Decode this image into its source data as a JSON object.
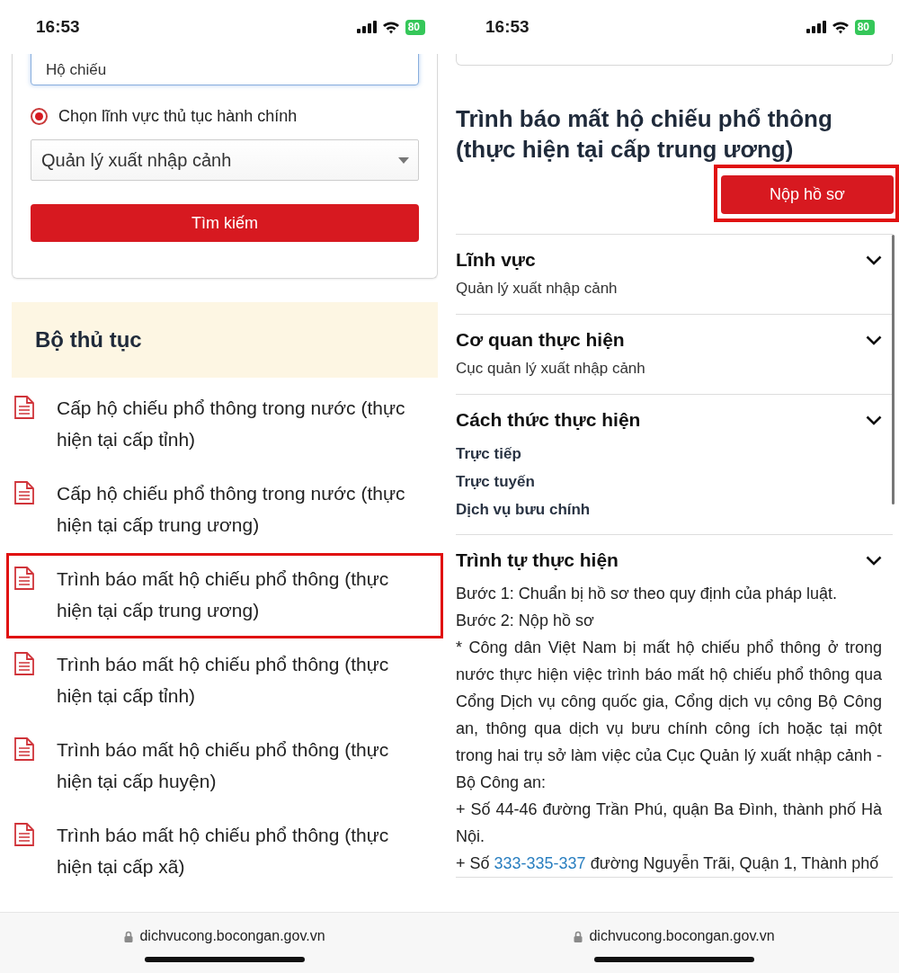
{
  "left": {
    "status_bar": {
      "time": "16:53",
      "battery": "80"
    },
    "search_card": {
      "keyword_value": "Hộ chiếu",
      "radio": {
        "label": "Chọn lĩnh vực thủ tục hành chính",
        "selected": true
      },
      "field_select": "Quản lý xuất nhập cảnh",
      "button": "Tìm kiếm"
    },
    "procedures": {
      "title": "Bộ thủ tục",
      "items": [
        {
          "label": "Cấp hộ chiếu phổ thông trong nước (thực hiện tại cấp tỉnh)",
          "highlighted": false
        },
        {
          "label": "Cấp hộ chiếu phổ thông trong nước (thực hiện tại cấp trung ương)",
          "highlighted": false
        },
        {
          "label": "Trình báo mất hộ chiếu phổ thông (thực hiện tại cấp trung ương)",
          "highlighted": true
        },
        {
          "label": "Trình báo mất hộ chiếu phổ thông (thực hiện tại cấp tỉnh)",
          "highlighted": false
        },
        {
          "label": "Trình báo mất hộ chiếu phổ thông (thực hiện tại cấp huyện)",
          "highlighted": false
        },
        {
          "label": "Trình báo mất hộ chiếu phổ thông (thực hiện tại cấp xã)",
          "highlighted": false
        }
      ]
    },
    "url_bar": {
      "url": "dichvucong.bocongan.gov.vn"
    }
  },
  "right": {
    "status_bar": {
      "time": "16:53",
      "battery": "80"
    },
    "detail": {
      "title": "Trình báo mất hộ chiếu phổ thông (thực hiện tại cấp trung ương)",
      "submit_button": {
        "label": "Nộp hồ sơ",
        "highlighted": true
      },
      "sections": [
        {
          "heading": "Lĩnh vực",
          "kind": "value",
          "lines": [
            "Quản lý xuất nhập cảnh"
          ]
        },
        {
          "heading": "Cơ quan thực hiện",
          "kind": "value",
          "lines": [
            "Cục quản lý xuất nhập cảnh"
          ]
        },
        {
          "heading": "Cách thức thực hiện",
          "kind": "options",
          "lines": [
            "Trực tiếp",
            "Trực tuyến",
            "Dịch vụ bưu chính"
          ]
        },
        {
          "heading": "Trình tự thực hiện",
          "kind": "steps",
          "paragraphs": [
            {
              "text": "Bước 1: Chuẩn bị hồ sơ theo quy định của pháp luật."
            },
            {
              "text": "Bước 2: Nộp hồ sơ"
            },
            {
              "text": "* Công dân Việt Nam bị mất hộ chiếu phổ thông ở trong nước thực hiện việc trình báo mất hộ chiếu phổ thông qua Cổng Dịch vụ công quốc gia, Cổng dịch vụ công Bộ Công an, thông qua dịch vụ bưu chính công ích hoặc tại một trong hai trụ sở làm việc của Cục Quản lý xuất nhập cảnh - Bộ Công an:"
            },
            {
              "text": "+ Số 44-46 đường Trần Phú, quận Ba Đình, thành phố Hà Nội."
            },
            {
              "text": "+ Số ",
              "link": "333-335-337",
              "after": " đường Nguyễn Trãi, Quận 1, Thành phố"
            }
          ]
        }
      ]
    },
    "url_bar": {
      "url": "dichvucong.bocongan.gov.vn"
    }
  }
}
